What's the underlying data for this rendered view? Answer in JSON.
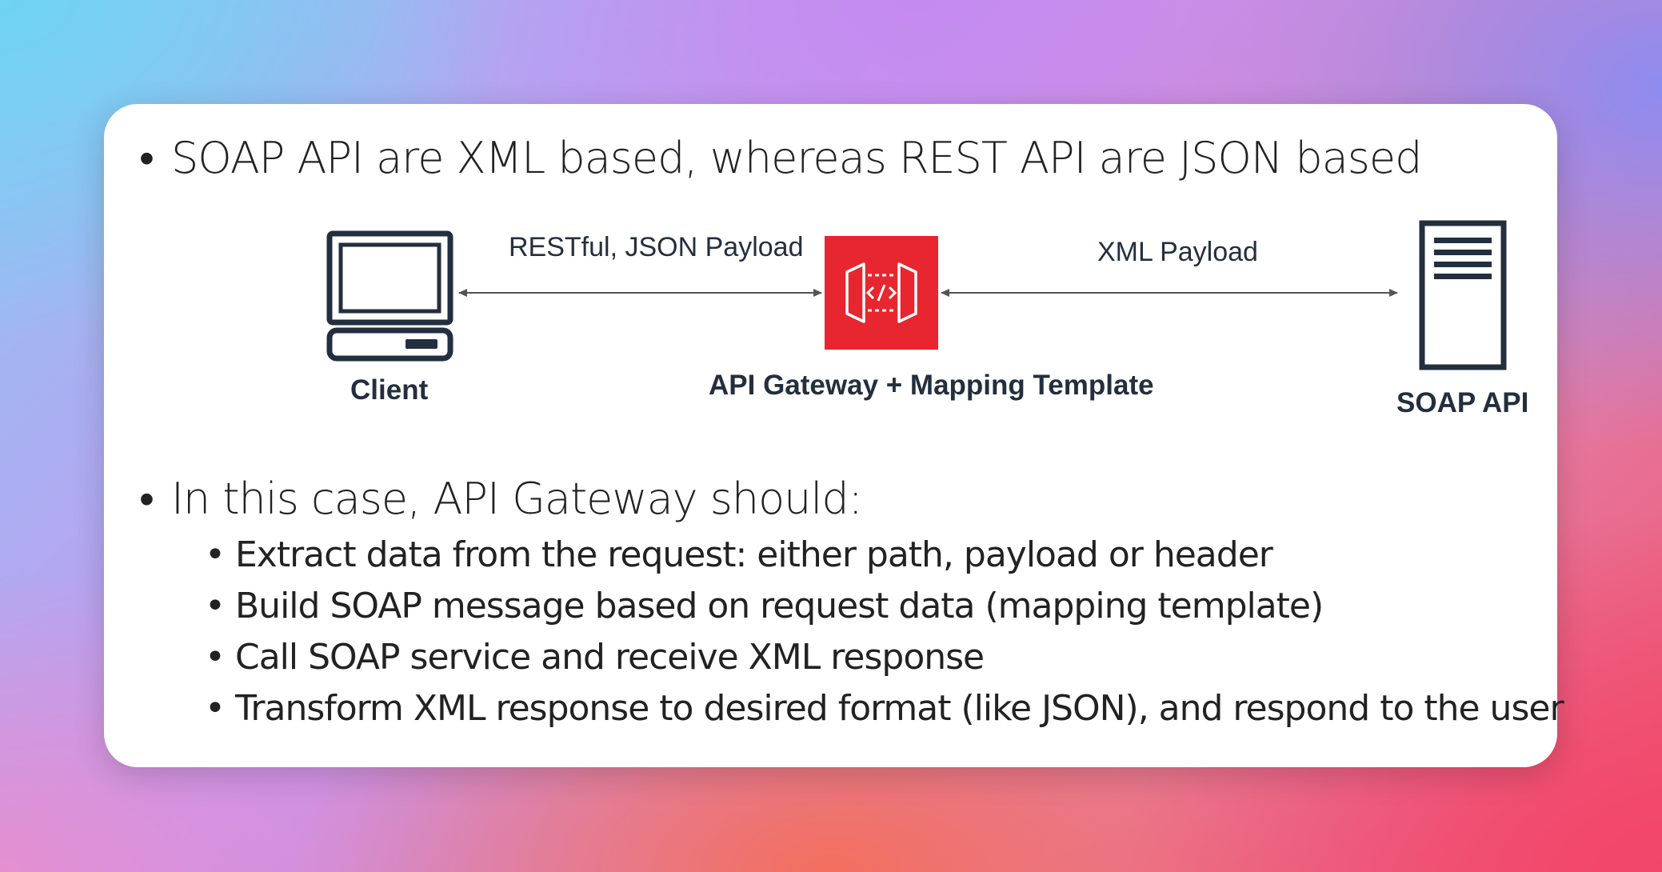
{
  "slide": {
    "bullet_1": "SOAP API are XML based, whereas REST API are JSON based",
    "bullet_2": "In this case, API Gateway should:",
    "sub_bullets": [
      "Extract data from the request: either path, payload or header",
      "Build SOAP message based on request data (mapping template)",
      "Call SOAP service and receive XML response",
      "Transform XML response to desired format (like JSON), and respond to the user"
    ],
    "bullet_char": "•"
  },
  "diagram": {
    "nodes": {
      "client": "Client",
      "api_gateway": "API Gateway + Mapping Template",
      "soap_api": "SOAP API"
    },
    "edges": {
      "client_to_gateway": "RESTful, JSON Payload",
      "gateway_to_soap": "XML Payload"
    },
    "icons": {
      "client": "desktop-computer-icon",
      "api_gateway": "api-gateway-icon",
      "soap_api": "server-icon"
    },
    "colors": {
      "api_gateway_fill": "#e7262f",
      "icon_stroke": "#232f3e",
      "arrow": "#555555"
    }
  }
}
